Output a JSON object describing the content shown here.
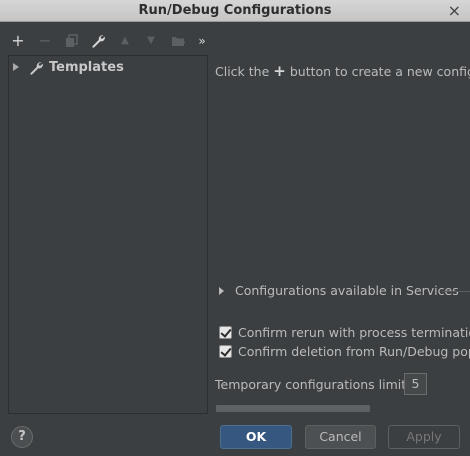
{
  "window": {
    "title": "Run/Debug Configurations",
    "close_glyph": "×"
  },
  "toolbar": {
    "items": [
      {
        "name": "add-icon",
        "glyph": "+",
        "enabled": true
      },
      {
        "name": "remove-icon",
        "glyph": "−",
        "enabled": false
      },
      {
        "name": "copy-icon",
        "glyph": "copy",
        "enabled": false
      },
      {
        "name": "wrench-icon",
        "glyph": "wrench",
        "enabled": true
      },
      {
        "name": "move-up-icon",
        "glyph": "▲",
        "enabled": false
      },
      {
        "name": "move-down-icon",
        "glyph": "▼",
        "enabled": false
      },
      {
        "name": "new-folder-icon",
        "glyph": "folder",
        "enabled": false
      },
      {
        "name": "more-icon",
        "glyph": "»",
        "enabled": true
      }
    ]
  },
  "tree": {
    "items": [
      {
        "label": "Templates",
        "icon": "wrench-icon",
        "expanded": false
      }
    ]
  },
  "main": {
    "hint_before": "Click the",
    "hint_plus": "+",
    "hint_after": "button to create a new configuration",
    "services_label": "Configurations available in Services",
    "confirm_rerun_label": "Confirm rerun with process termination",
    "confirm_rerun_checked": true,
    "confirm_deletion_label": "Confirm deletion from Run/Debug popup",
    "confirm_deletion_checked": true,
    "limit_label": "Temporary configurations limit:",
    "limit_value": "5"
  },
  "footer": {
    "help_label": "?",
    "ok_label": "OK",
    "cancel_label": "Cancel",
    "apply_label": "Apply"
  },
  "colors": {
    "background": "#3c3f41",
    "primary_button": "#365880",
    "text": "#bbbbbb",
    "title_bar": "#cfcfcf"
  }
}
